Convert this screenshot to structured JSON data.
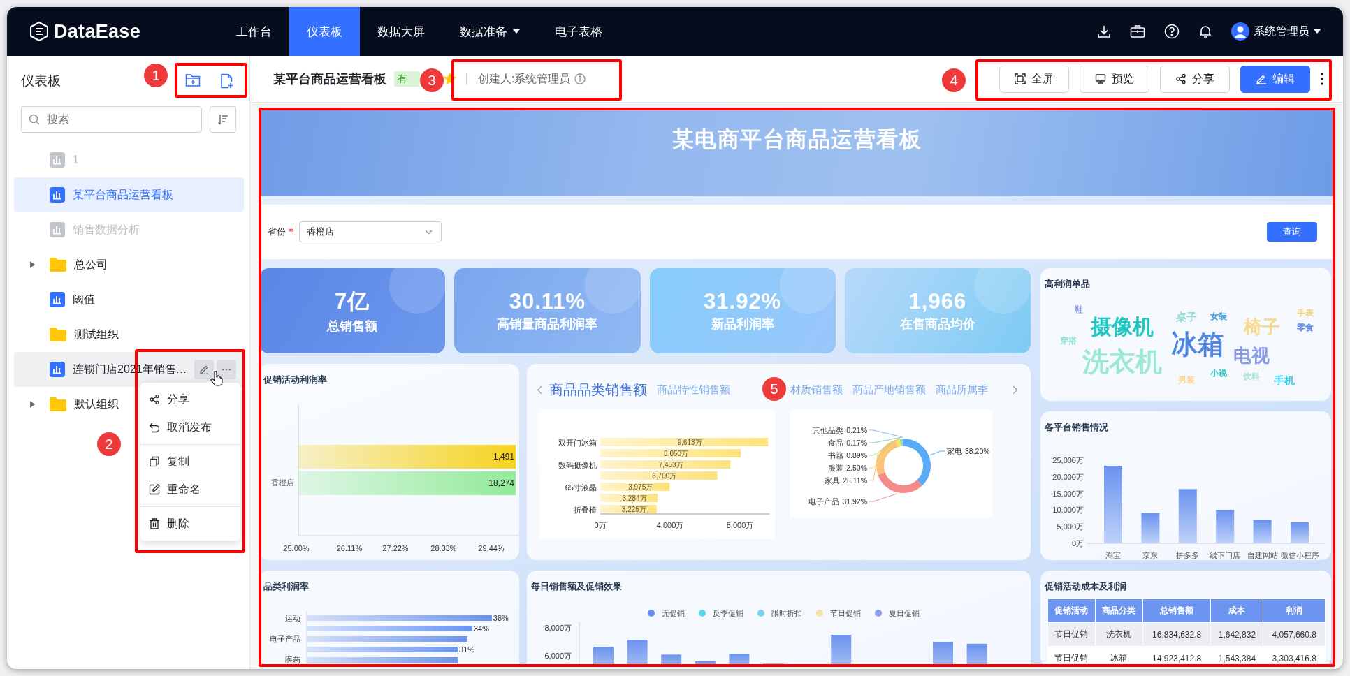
{
  "nav": {
    "logo": "DataEase",
    "items": [
      {
        "label": "工作台",
        "selected": false,
        "dropdown": false
      },
      {
        "label": "仪表板",
        "selected": true,
        "dropdown": false
      },
      {
        "label": "数据大屏",
        "selected": false,
        "dropdown": false
      },
      {
        "label": "数据准备",
        "selected": false,
        "dropdown": true
      },
      {
        "label": "电子表格",
        "selected": false,
        "dropdown": false
      }
    ],
    "user": "系统管理员"
  },
  "sidebar": {
    "title": "仪表板",
    "search": {
      "placeholder": "搜索"
    },
    "tree": [
      {
        "label": "1",
        "kind": "dashboard",
        "selected": false,
        "disabled": true,
        "hovered": false
      },
      {
        "label": "某平台商品运营看板",
        "kind": "dashboard",
        "selected": true,
        "disabled": false,
        "hovered": false
      },
      {
        "label": "销售数据分析",
        "kind": "dashboard",
        "selected": false,
        "disabled": true,
        "hovered": false
      },
      {
        "label": "总公司",
        "kind": "folder",
        "expandable": true,
        "selected": false,
        "disabled": false,
        "hovered": false
      },
      {
        "label": "阈值",
        "kind": "dashboard",
        "selected": false,
        "disabled": false,
        "hovered": false
      },
      {
        "label": "测试组织",
        "kind": "folder",
        "expandable": false,
        "selected": false,
        "disabled": false,
        "hovered": false
      },
      {
        "label": "连锁门店2021年销售…",
        "kind": "dashboard",
        "selected": false,
        "disabled": false,
        "hovered": true
      },
      {
        "label": "默认组织",
        "kind": "folder",
        "expandable": true,
        "selected": false,
        "disabled": false,
        "hovered": false
      }
    ],
    "context_menu": {
      "groups": [
        [
          {
            "label": "分享",
            "kind": "share"
          },
          {
            "label": "取消发布",
            "kind": "unpublish"
          }
        ],
        [
          {
            "label": "复制",
            "kind": "copy"
          },
          {
            "label": "重命名",
            "kind": "rename"
          }
        ],
        [
          {
            "label": "删除",
            "kind": "delete"
          }
        ]
      ]
    }
  },
  "header": {
    "title": "某平台商品运营看板",
    "status_tag": "有",
    "favorite": true,
    "creator": "创建人:系统管理员",
    "buttons": [
      {
        "label": "全屏",
        "kind": "fullscreen",
        "primary": false
      },
      {
        "label": "预览",
        "kind": "preview",
        "primary": false
      },
      {
        "label": "分享",
        "kind": "share",
        "primary": false
      },
      {
        "label": "编辑",
        "kind": "edit",
        "primary": true
      }
    ]
  },
  "dashboard": {
    "banner_title": "某电商平台商品运营看板",
    "filter": {
      "label": "省份",
      "required": true,
      "value": "香橙店",
      "button": "查询"
    },
    "kpis": [
      {
        "value": "7亿",
        "label": "总销售额"
      },
      {
        "value": "30.11%",
        "label": "高销量商品利润率"
      },
      {
        "value": "31.92%",
        "label": "新品利润率"
      },
      {
        "value": "1,966",
        "label": "在售商品均价"
      }
    ],
    "promo_profit": {
      "title": "促销活动利润率",
      "category": "香橙店",
      "bars": [
        {
          "label": "1,491",
          "color": "#f5d320"
        },
        {
          "label": "18,274",
          "color": "#92ea98"
        }
      ],
      "axis_labels": [
        "25.00%",
        "26.11%",
        "27.22%",
        "28.33%",
        "29.44%"
      ]
    },
    "category_sales": {
      "tabs": [
        {
          "label": "商品品类销售额",
          "selected": true
        },
        {
          "label": "商品特性销售额",
          "selected": false
        },
        {
          "label": "材质销售额",
          "selected": false
        },
        {
          "label": "商品产地销售额",
          "selected": false
        },
        {
          "label": "商品所属季",
          "selected": false
        }
      ],
      "bar_chart": {
        "chart_data": {
          "type": "bar",
          "orientation": "horizontal",
          "categories": [
            "双开门冰箱",
            null,
            "数码摄像机",
            null,
            "65寸液晶",
            null,
            "折叠椅"
          ],
          "values": [
            9613,
            8050,
            7453,
            6700,
            3975,
            3284,
            3225
          ],
          "value_labels": [
            "9,613万",
            "8,050万",
            "7,453万",
            "6,700万",
            "3,975万",
            "3,284万",
            "3,225万"
          ],
          "xlim": [
            0,
            9700
          ],
          "xticks": [
            {
              "value": 0,
              "label": "0万"
            },
            {
              "value": 4000,
              "label": "4,000万"
            },
            {
              "value": 8000,
              "label": "8,000万"
            }
          ]
        }
      },
      "donut_chart": {
        "chart_data": {
          "type": "donut",
          "categories": [
            "家电",
            "电子产品",
            "家具",
            "服装",
            "书籍",
            "食品",
            "其他品类"
          ],
          "values": [
            38.2,
            31.92,
            26.11,
            2.5,
            0.89,
            0.17,
            0.21
          ],
          "colors": [
            "#5aabf5",
            "#f38b8b",
            "#fbc379",
            "#f7e36b",
            "#a0e07a",
            "#7fd3c8",
            "#8fb3f0"
          ],
          "value_labels": [
            "38.20%",
            "31.92%",
            "26.11%",
            "2.50%",
            "0.89%",
            "0.17%",
            "0.21%"
          ]
        }
      }
    },
    "word_cloud": {
      "title": "高利润单品",
      "words": [
        {
          "text": "鞋",
          "kind": "sm",
          "color": "#8a9be8"
        },
        {
          "text": "摄像机",
          "kind": "xl",
          "color": "#1fc7c0"
        },
        {
          "text": "穿搭",
          "kind": "sm",
          "color": "#8fe0d0"
        },
        {
          "text": "洗衣机",
          "kind": "xxl",
          "color": "#9be8d4"
        },
        {
          "text": "桌子",
          "kind": "md",
          "color": "#8fe0d0"
        },
        {
          "text": "女装",
          "kind": "sm",
          "color": "#3b9fe0"
        },
        {
          "text": "冰箱",
          "kind": "xxl",
          "color": "#4f86e0"
        },
        {
          "text": "椅子",
          "kind": "lg",
          "color": "#f8d98a"
        },
        {
          "text": "电视",
          "kind": "lg",
          "color": "#8a9be8"
        },
        {
          "text": "手表",
          "kind": "sm",
          "color": "#f2d27a"
        },
        {
          "text": "零食",
          "kind": "sm",
          "color": "#5b86e0"
        },
        {
          "text": "男装",
          "kind": "sm",
          "color": "#fbd48a"
        },
        {
          "text": "小说",
          "kind": "sm",
          "color": "#1fc7c0"
        },
        {
          "text": "饮料",
          "kind": "sm",
          "color": "#a8e0d6"
        },
        {
          "text": "手机",
          "kind": "md",
          "color": "#3ad0f0"
        }
      ]
    },
    "platform_sales": {
      "title": "各平台销售情况",
      "chart_data": {
        "type": "bar",
        "categories": [
          "淘宝",
          "京东",
          "拼多多",
          "线下门店",
          "自建网站",
          "微信小程序"
        ],
        "values": [
          23300,
          9100,
          16300,
          10000,
          7000,
          6300
        ],
        "ylim": [
          0,
          25000
        ],
        "yticks": [
          {
            "value": 0,
            "label": "0万"
          },
          {
            "value": 5000,
            "label": "5,000万"
          },
          {
            "value": 10000,
            "label": "10,000万"
          },
          {
            "value": 15000,
            "label": "15,000万"
          },
          {
            "value": 20000,
            "label": "20,000万"
          },
          {
            "value": 25000,
            "label": "25,000万"
          }
        ]
      }
    },
    "category_profit": {
      "title": "品类利润率",
      "chart_data": {
        "type": "bar",
        "orientation": "horizontal",
        "categories": [
          "运动",
          null,
          "电子产品",
          null,
          "医药"
        ],
        "values": [
          38,
          34,
          33,
          31,
          31
        ],
        "value_labels": [
          "38%",
          "34%",
          null,
          "31%",
          null
        ]
      }
    },
    "daily_sales": {
      "title": "每日销售额及促销效果",
      "legend": [
        {
          "label": "无促销",
          "color": "#6b8ff0"
        },
        {
          "label": "反季促销",
          "color": "#5ad8e6"
        },
        {
          "label": "限时折扣",
          "color": "#7fd0ee"
        },
        {
          "label": "节日促销",
          "color": "#f4e4a8"
        },
        {
          "label": "夏日促销",
          "color": "#8fa0ea"
        }
      ],
      "axis_labels": [
        "8,000万",
        "6,000万"
      ]
    },
    "promo_table": {
      "title": "促销活动成本及利润",
      "columns": [
        "促销活动",
        "商品分类",
        "总销售额",
        "成本",
        "利润"
      ],
      "rows": [
        [
          "节日促销",
          "洗衣机",
          "16,834,632.8",
          "1,642,832",
          "4,057,660.8"
        ],
        [
          "节日促销",
          "冰箱",
          "14,923,412.8",
          "1,543,384",
          "3,303,416.8"
        ]
      ]
    }
  },
  "callouts": [
    {
      "number": "1"
    },
    {
      "number": "2"
    },
    {
      "number": "3"
    },
    {
      "number": "4"
    },
    {
      "number": "5"
    }
  ]
}
